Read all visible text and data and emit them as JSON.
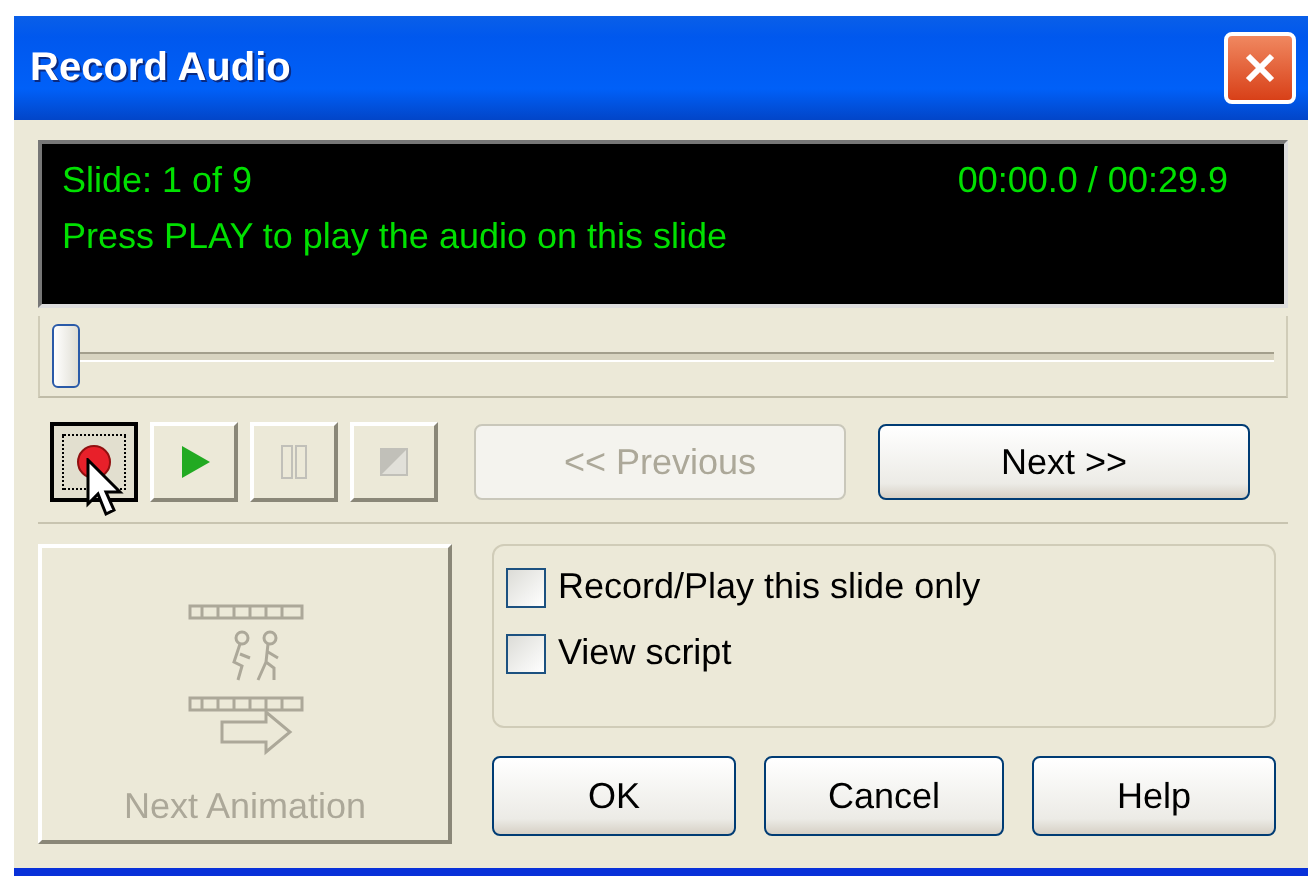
{
  "window": {
    "title": "Record Audio"
  },
  "display": {
    "slide": "Slide: 1 of 9",
    "time": "00:00.0 / 00:29.9",
    "message": "Press PLAY to play the audio on this slide"
  },
  "slider": {
    "level": 0
  },
  "transport": [
    {
      "kind": "record",
      "pressed": true,
      "disabled": false
    },
    {
      "kind": "play",
      "pressed": false,
      "disabled": false
    },
    {
      "kind": "pause",
      "pressed": false,
      "disabled": true
    },
    {
      "kind": "stop",
      "pressed": false,
      "disabled": true
    }
  ],
  "navigation": [
    {
      "label": "<< Previous",
      "disabled": true
    },
    {
      "label": "Next >>",
      "disabled": false
    }
  ],
  "next_animation": {
    "label": "Next Animation",
    "disabled": true
  },
  "options": [
    {
      "label": "Record/Play this slide only",
      "checked": false
    },
    {
      "label": "View script",
      "checked": false
    }
  ],
  "buttons": [
    "OK",
    "Cancel",
    "Help"
  ]
}
